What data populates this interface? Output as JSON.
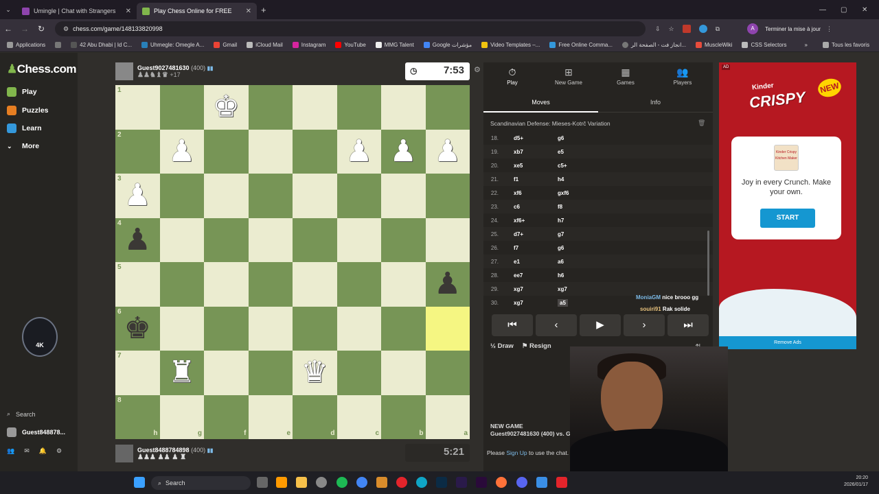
{
  "browser": {
    "tabs": [
      {
        "title": "Umingle | Chat with Strangers",
        "color": "#8e44ad"
      },
      {
        "title": "Play Chess Online for FREE",
        "color": "#81b64c",
        "active": true
      }
    ],
    "url": "chess.com/game/148133820998",
    "update_label": "Terminer la mise à jour",
    "profile_initial": "A",
    "bookmarks": [
      "Applications",
      "42 Abu Dhabi | Id C...",
      "Uhmegle: Omegle A...",
      "Gmail",
      "iCloud Mail",
      "Instagram",
      "YouTube",
      "MMG Talent",
      "Google مؤشرات",
      "Video Templates –...",
      "Free Online Comma...",
      "انجاز فت - الصفحة الر...",
      "MuscleWiki",
      "CSS Selectors"
    ],
    "all_bookmarks": "Tous les favoris"
  },
  "sidebar": {
    "logo": "Chess.com",
    "items": [
      "Play",
      "Puzzles",
      "Learn",
      "More"
    ],
    "badge": "4K",
    "search_label": "Search",
    "user": "Guest848878..."
  },
  "game": {
    "top_player": {
      "name": "Guest9027481630",
      "rating": "(400)",
      "material": "+17"
    },
    "bottom_player": {
      "name": "Guest8488784898",
      "rating": "(400)"
    },
    "top_clock": "7:53",
    "bottom_clock": "5:21",
    "files": [
      "h",
      "g",
      "f",
      "e",
      "d",
      "c",
      "b",
      "a"
    ],
    "ranks": [
      "1",
      "2",
      "3",
      "4",
      "5",
      "6",
      "7",
      "8"
    ],
    "board": [
      [
        "",
        "",
        "wK",
        "",
        "",
        "",
        "",
        ""
      ],
      [
        "",
        "wP",
        "",
        "",
        "",
        "wP",
        "wP",
        "wP"
      ],
      [
        "wP",
        "",
        "",
        "",
        "",
        "",
        "",
        ""
      ],
      [
        "bP",
        "",
        "",
        "",
        "",
        "",
        "",
        ""
      ],
      [
        "",
        "",
        "",
        "",
        "",
        "",
        "",
        "bP"
      ],
      [
        "bK",
        "",
        "",
        "",
        "",
        "",
        "",
        "hl"
      ],
      [
        "",
        "wR",
        "",
        "",
        "wQ",
        "",
        "",
        ""
      ],
      [
        "",
        "",
        "",
        "",
        "",
        "",
        "",
        ""
      ]
    ]
  },
  "panel": {
    "tabs": [
      "Play",
      "New Game",
      "Games",
      "Players"
    ],
    "subtabs": [
      "Moves",
      "Info"
    ],
    "opening": "Scandinavian Defense: Mieses-Kotrč Variation",
    "moves": [
      {
        "n": "18.",
        "w": "d5+",
        "b": "g6"
      },
      {
        "n": "19.",
        "w": "xb7",
        "b": "e5"
      },
      {
        "n": "20.",
        "w": "xe5",
        "b": "c5+"
      },
      {
        "n": "21.",
        "w": "f1",
        "b": "h4"
      },
      {
        "n": "22.",
        "w": "xf6",
        "b": "gxf6"
      },
      {
        "n": "23.",
        "w": "c6",
        "b": "f8"
      },
      {
        "n": "24.",
        "w": "xf6+",
        "b": "h7"
      },
      {
        "n": "25.",
        "w": "d7+",
        "b": "g7"
      },
      {
        "n": "26.",
        "w": "f7",
        "b": "g6"
      },
      {
        "n": "27.",
        "w": "e1",
        "b": "a6"
      },
      {
        "n": "28.",
        "w": "ee7",
        "b": "h6"
      },
      {
        "n": "29.",
        "w": "xg7",
        "b": "xg7"
      },
      {
        "n": "30.",
        "w": "xg7",
        "b": "a5"
      }
    ],
    "chat": [
      {
        "user": "MoniaGM",
        "text": "nice brooo gg"
      },
      {
        "user": "souiri91",
        "text": "Rak solide"
      }
    ],
    "controls": [
      "⏮",
      "‹",
      "▶",
      "›",
      "⏭"
    ],
    "draw_label": "Draw",
    "resign_label": "Resign",
    "new_game_title": "NEW GAME",
    "new_game_line": "Guest9027481630 (400) vs. Gues",
    "chat_prompt": "Please",
    "chat_link": "Sign Up",
    "chat_suffix": "to use the chat."
  },
  "ad": {
    "label": "AD",
    "brand_top": "Kinder",
    "brand": "CRISPY",
    "new": "NEW",
    "card_img": "Kinder Crispy Kitchen Maker",
    "text": "Joy in every Crunch. Make your own.",
    "cta": "START",
    "remove": "Remove Ads"
  },
  "taskbar": {
    "search": "Search",
    "time": "20:20",
    "date": "2026/01/17"
  }
}
